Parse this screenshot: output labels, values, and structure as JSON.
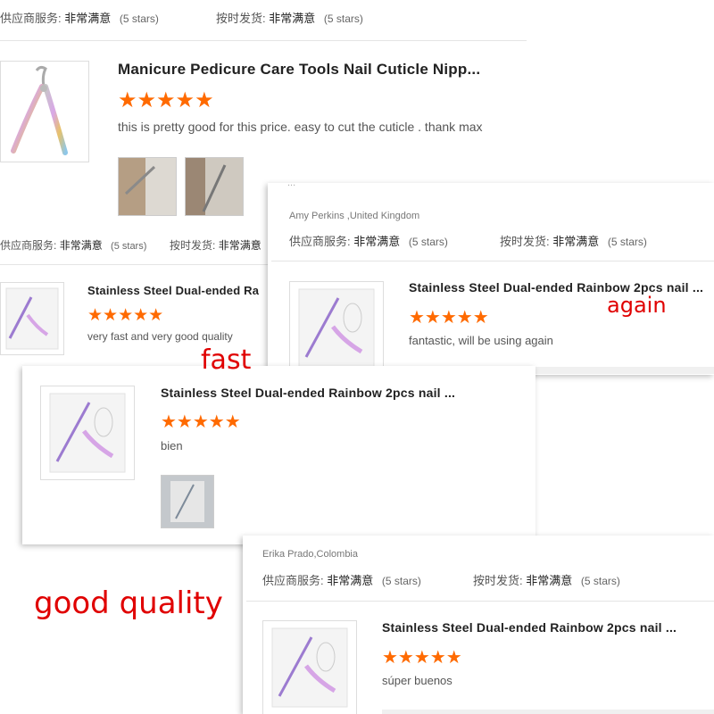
{
  "colors": {
    "star": "#ff6a00",
    "overlay_text": "#e00000"
  },
  "icons": {
    "star": "star-icon"
  },
  "card_top": {
    "supplier_label": "供应商服务:",
    "supplier_value": "非常满意",
    "supplier_stars": "(5 stars)",
    "shipping_label": "按时发货:",
    "shipping_value": "非常满意",
    "shipping_stars": "(5 stars)",
    "product_title": "Manicure Pedicure Care Tools Nail Cuticle Nipp...",
    "rating": 5,
    "review_text": "this is pretty good for this price. easy to cut the cuticle . thank max"
  },
  "card_middle": {
    "supplier_label": "供应商服务:",
    "supplier_value": "非常满意",
    "supplier_stars": "(5 stars)",
    "shipping_label": "按时发货:",
    "shipping_value": "非常满意",
    "product_title": "Stainless Steel Dual-ended Ra",
    "rating": 5,
    "review_text": "very fast and very good quality"
  },
  "card_right": {
    "partial_text": "...",
    "reviewer": "Amy Perkins ,United Kingdom",
    "supplier_label": "供应商服务:",
    "supplier_value": "非常满意",
    "supplier_stars": "(5 stars)",
    "shipping_label": "按时发货:",
    "shipping_value": "非常满意",
    "shipping_stars": "(5 stars)",
    "product_title": "Stainless Steel Dual-ended Rainbow 2pcs nail ...",
    "rating": 5,
    "review_text": "fantastic, will be using again"
  },
  "card_center": {
    "product_title": "Stainless Steel Dual-ended Rainbow 2pcs nail ...",
    "rating": 5,
    "review_text": "bien"
  },
  "card_bottom": {
    "reviewer": "Erika Prado,Colombia",
    "supplier_label": "供应商服务:",
    "supplier_value": "非常满意",
    "supplier_stars": "(5 stars)",
    "shipping_label": "按时发货:",
    "shipping_value": "非常满意",
    "shipping_stars": "(5 stars)",
    "product_title": "Stainless Steel Dual-ended Rainbow 2pcs nail ...",
    "rating": 5,
    "review_text": "súper buenos"
  },
  "annotations": {
    "fast": "fast",
    "again": "again",
    "good_quality": "good quality"
  },
  "stars_glyph": "★★★★★"
}
